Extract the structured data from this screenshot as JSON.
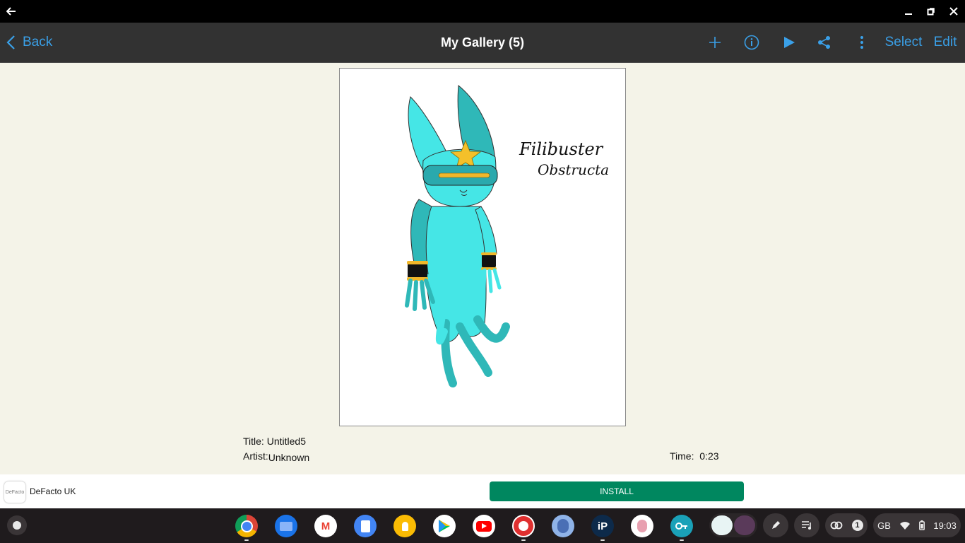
{
  "window": {
    "back_icon": "arrow-left-icon",
    "minimize_icon": "minimize-icon",
    "restore_icon": "restore-icon",
    "close_icon": "close-icon"
  },
  "appbar": {
    "back_label": "Back",
    "title": "My Gallery (5)",
    "select_label": "Select",
    "edit_label": "Edit",
    "accent_color": "#3aa0e8"
  },
  "artwork": {
    "text_line1": "Filibuster",
    "text_line2": "Obstructa"
  },
  "details": {
    "title_label": "Title:",
    "title_value": "Untitled5",
    "artist_label": "Artist:",
    "artist_value": "Unknown",
    "time_label": "Time:",
    "time_value": "0:23"
  },
  "ad": {
    "logo_text": "DeFacto",
    "advertiser": "DeFacto UK",
    "install_label": "INSTALL",
    "install_color": "#00875f"
  },
  "shelf": {
    "apps": [
      "Chrome",
      "Files",
      "Gmail",
      "Docs",
      "Keep",
      "Play Store",
      "YouTube",
      "App",
      "App",
      "ibis Paint",
      "App",
      "App",
      "Window"
    ],
    "pen_icon": "stylus-icon",
    "media_icon": "playlist-icon",
    "notification_count": "1",
    "keyboard_layout": "GB",
    "clock": "19:03"
  }
}
